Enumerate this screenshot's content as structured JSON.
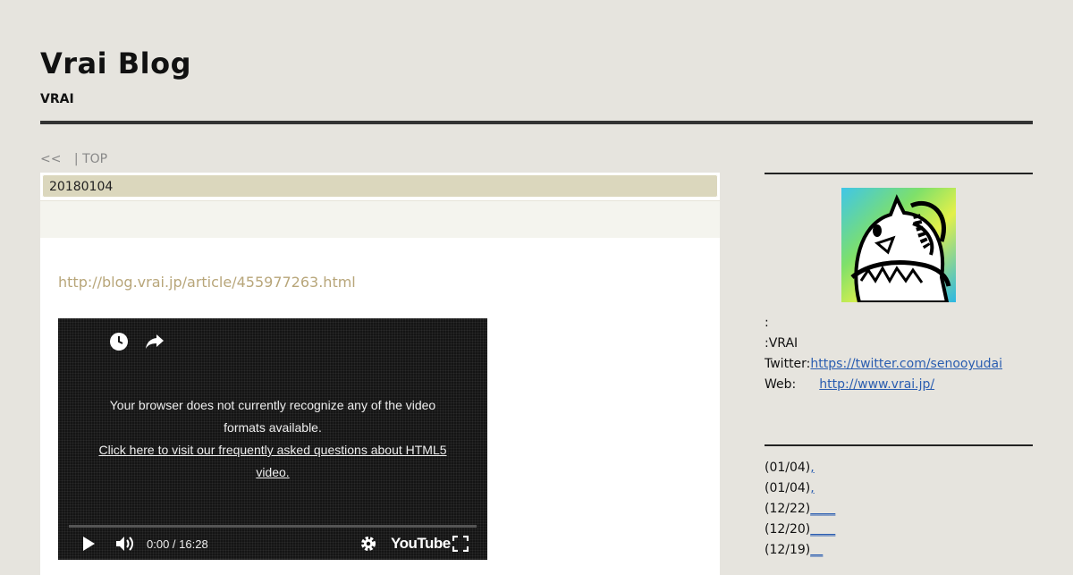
{
  "header": {
    "title": "Vrai Blog",
    "subtitle": "VRAI"
  },
  "breadcrumb": {
    "prev": "<<",
    "top": "| TOP"
  },
  "article": {
    "date": "20180104",
    "link": "http://blog.vrai.jp/article/455977263.html"
  },
  "video": {
    "message": "Your browser does not currently recognize any of the video formats available.",
    "faq_link": "Click here to visit our frequently asked questions about HTML5 video.",
    "time": "0:00 / 16:28",
    "brand": "YouTube",
    "progress": 0
  },
  "profile": {
    "name_label": ":",
    "handle": ":VRAI",
    "twitter_label": "Twitter:",
    "twitter_url": "https://twitter.com/senooyudai",
    "web_label": "Web:",
    "web_url": "http://www.vrai.jp/"
  },
  "recent": [
    {
      "date": "(01/04)",
      "title": ","
    },
    {
      "date": "(01/04)",
      "title": ","
    },
    {
      "date": "(12/22)",
      "title": "____"
    },
    {
      "date": "(12/20)",
      "title": "____"
    },
    {
      "date": "(12/19)",
      "title": "__"
    }
  ],
  "colors": {
    "background": "#e6e4de",
    "date_bar": "#dbd7bd",
    "link": "#b8a67a",
    "side_link": "#2a5db0"
  }
}
